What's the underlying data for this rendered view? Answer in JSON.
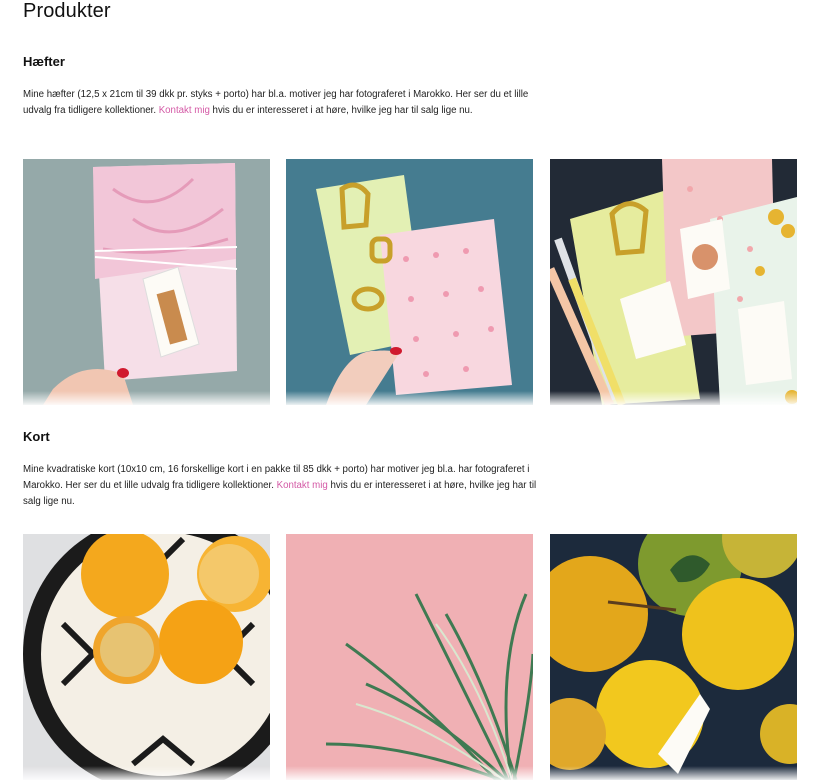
{
  "page": {
    "title": "Produkter"
  },
  "sections": [
    {
      "title": "Hæfter",
      "text_before": "Mine hæfter (12,5 x 21cm til 39 dkk pr. styks + porto) har bl.a. motiver jeg har fotograferet i Marokko. Her ser du et lille udvalg fra tidligere kollektioner. ",
      "link": "Kontakt mig",
      "text_after": " hvis du er interesseret i at høre, hvilke jeg har til salg lige nu.",
      "images": [
        "pink-notebook-giraffe-tag",
        "notebooks-on-blue-background",
        "notebooks-with-pens-and-tags"
      ]
    },
    {
      "title": "Kort",
      "text_before": "Mine kvadratiske kort (10x10 cm, 16 forskellige kort i en pakke til 85 dkk + porto) har motiver jeg bl.a. har fotograferet i Marokko. Her ser du et lille udvalg fra tidligere kollektioner. ",
      "link": "Kontakt mig",
      "text_after": " hvis du er interesseret i at høre, hvilke jeg har til salg lige nu.",
      "images": [
        "oranges-in-patterned-bowl",
        "palm-leaves-on-pink-wall",
        "citrus-fruits-closeup"
      ]
    }
  ],
  "colors": {
    "link": "#d45aa6"
  }
}
